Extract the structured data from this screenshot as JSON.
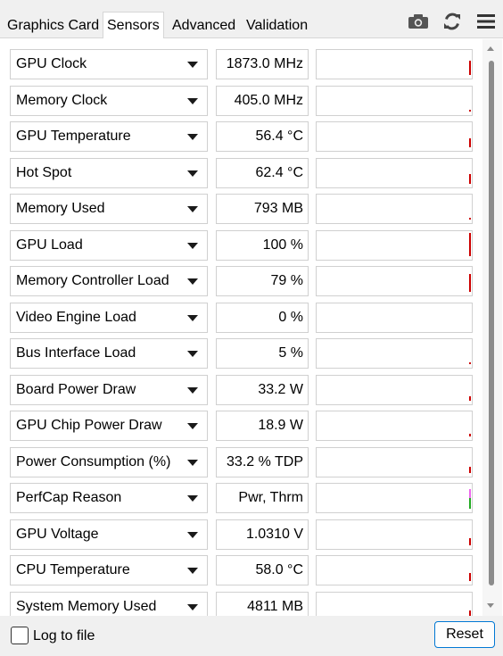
{
  "tabs": [
    {
      "label": "Graphics Card",
      "active": false
    },
    {
      "label": "Sensors",
      "active": true
    },
    {
      "label": "Advanced",
      "active": false
    },
    {
      "label": "Validation",
      "active": false
    }
  ],
  "toolbar": {
    "icons": [
      "camera-icon",
      "refresh-icon",
      "menu-icon"
    ]
  },
  "sensors": [
    {
      "name": "GPU Clock",
      "value": "1873.0 MHz",
      "graph_level": 0.62,
      "color": "#cc0000"
    },
    {
      "name": "Memory Clock",
      "value": "405.0 MHz",
      "graph_level": 0.07,
      "color": "#cc0000"
    },
    {
      "name": "GPU Temperature",
      "value": "56.4 °C",
      "graph_level": 0.38,
      "color": "#cc0000"
    },
    {
      "name": "Hot Spot",
      "value": "62.4 °C",
      "graph_level": 0.42,
      "color": "#cc0000"
    },
    {
      "name": "Memory Used",
      "value": "793 MB",
      "graph_level": 0.09,
      "color": "#cc0000"
    },
    {
      "name": "GPU Load",
      "value": "100 %",
      "graph_level": 1.0,
      "color": "#cc0000"
    },
    {
      "name": "Memory Controller Load",
      "value": "79 %",
      "graph_level": 0.79,
      "color": "#cc0000"
    },
    {
      "name": "Video Engine Load",
      "value": "0 %",
      "graph_level": 0.0,
      "color": "#cc0000"
    },
    {
      "name": "Bus Interface Load",
      "value": "5 %",
      "graph_level": 0.05,
      "color": "#cc0000"
    },
    {
      "name": "Board Power Draw",
      "value": "33.2 W",
      "graph_level": 0.2,
      "color": "#cc0000"
    },
    {
      "name": "GPU Chip Power Draw",
      "value": "18.9 W",
      "graph_level": 0.11,
      "color": "#cc0000"
    },
    {
      "name": "Power Consumption (%)",
      "value": "33.2 % TDP",
      "graph_level": 0.28,
      "color": "#cc0000"
    },
    {
      "name": "PerfCap Reason",
      "value": "Pwr, Thrm",
      "graph_level": 0.8,
      "color": "#22aa22",
      "color2": "#ee66ee"
    },
    {
      "name": "GPU Voltage",
      "value": "1.0310 V",
      "graph_level": 0.3,
      "color": "#cc0000"
    },
    {
      "name": "CPU Temperature",
      "value": "58.0 °C",
      "graph_level": 0.35,
      "color": "#cc0000"
    },
    {
      "name": "System Memory Used",
      "value": "4811 MB",
      "graph_level": 0.3,
      "color": "#cc0000"
    }
  ],
  "footer": {
    "log_label": "Log to file",
    "log_checked": false,
    "reset_label": "Reset"
  }
}
